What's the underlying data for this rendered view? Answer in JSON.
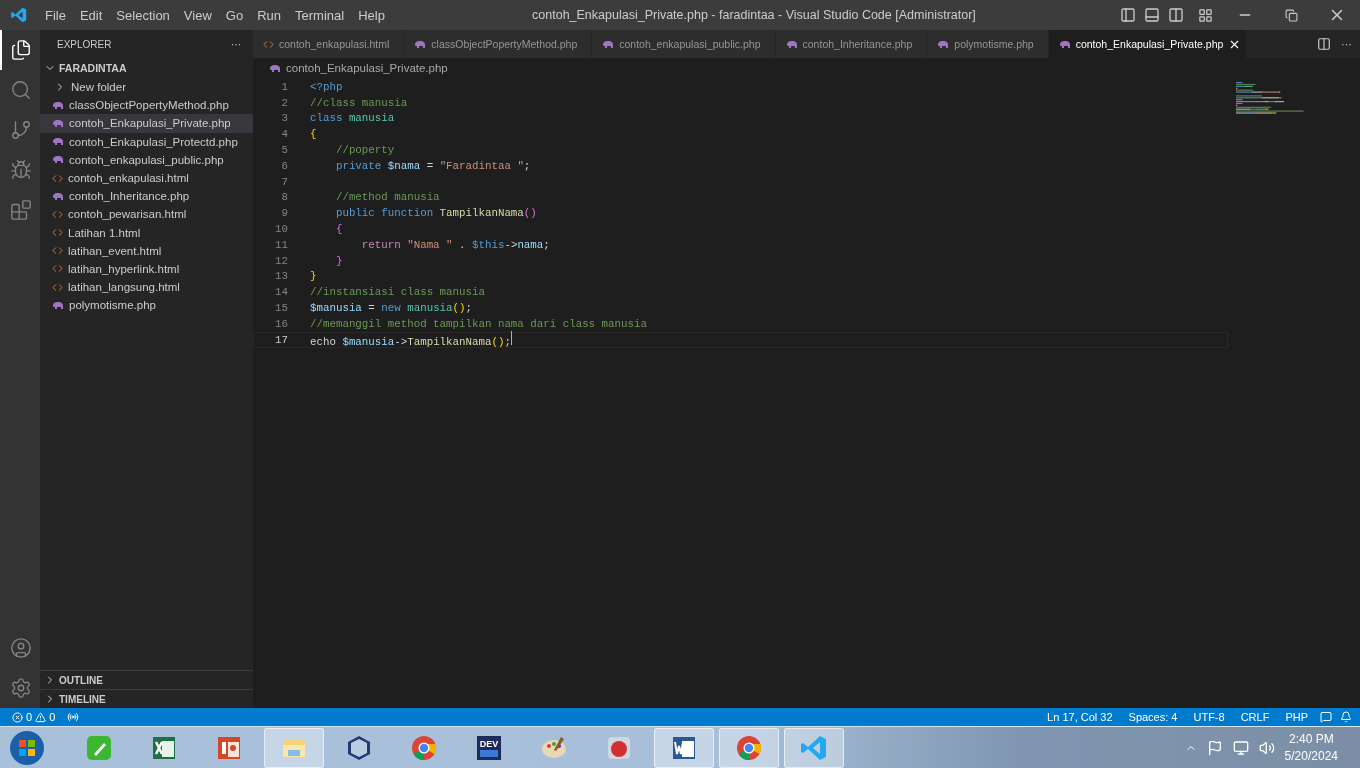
{
  "menu": [
    "File",
    "Edit",
    "Selection",
    "View",
    "Go",
    "Run",
    "Terminal",
    "Help"
  ],
  "window": {
    "title": "contoh_Enkapulasi_Private.php - faradintaa - Visual Studio Code [Administrator]"
  },
  "activity_bar": [
    {
      "kind": "files",
      "selected": true
    },
    {
      "kind": "search",
      "selected": false
    },
    {
      "kind": "source-control",
      "selected": false
    },
    {
      "kind": "run",
      "selected": false
    },
    {
      "kind": "extensions",
      "selected": false
    }
  ],
  "sidebar": {
    "title": "EXPLORER",
    "more": "···",
    "folder": {
      "name": "FARADINTAA",
      "expanded": true
    },
    "items": [
      {
        "kind": "folder",
        "name": "New folder",
        "selected": false
      },
      {
        "kind": "php",
        "name": "classObjectPopertyMethod.php",
        "selected": false
      },
      {
        "kind": "php",
        "name": "contoh_Enkapulasi_Private.php",
        "selected": true
      },
      {
        "kind": "php",
        "name": "contoh_Enkapulasi_Protectd.php",
        "selected": false
      },
      {
        "kind": "php",
        "name": "contoh_enkapulasi_public.php",
        "selected": false
      },
      {
        "kind": "html",
        "name": "contoh_enkapulasi.html",
        "selected": false
      },
      {
        "kind": "php",
        "name": "contoh_Inheritance.php",
        "selected": false
      },
      {
        "kind": "html",
        "name": "contoh_pewarisan.html",
        "selected": false
      },
      {
        "kind": "html",
        "name": "Latihan 1.html",
        "selected": false
      },
      {
        "kind": "html",
        "name": "latihan_event.html",
        "selected": false
      },
      {
        "kind": "html",
        "name": "latihan_hyperlink.html",
        "selected": false
      },
      {
        "kind": "html",
        "name": "latihan_langsung.html",
        "selected": false
      },
      {
        "kind": "php",
        "name": "polymotisme.php",
        "selected": false
      }
    ],
    "sections": [
      {
        "title": "OUTLINE",
        "expanded": false
      },
      {
        "title": "TIMELINE",
        "expanded": false
      }
    ]
  },
  "tabs": [
    {
      "kind": "html",
      "label": "contoh_enkapulasi.html",
      "selected": false
    },
    {
      "kind": "php",
      "label": "classObjectPopertyMethod.php",
      "selected": false
    },
    {
      "kind": "php",
      "label": "contoh_enkapulasi_public.php",
      "selected": false
    },
    {
      "kind": "php",
      "label": "contoh_Inheritance.php",
      "selected": false
    },
    {
      "kind": "php",
      "label": "polymotisme.php",
      "selected": false
    },
    {
      "kind": "php",
      "label": "contoh_Enkapulasi_Private.php",
      "selected": true
    }
  ],
  "tab_actions": {
    "more": "···"
  },
  "breadcrumb": {
    "kind": "php",
    "label": "contoh_Enkapulasi_Private.php"
  },
  "editor": {
    "lines": [
      {
        "number": "1",
        "current": false,
        "tokens": [
          {
            "kind": "tag",
            "text": "<?php"
          }
        ]
      },
      {
        "number": "2",
        "current": false,
        "tokens": [
          {
            "kind": "comment",
            "text": "//class manusia"
          }
        ]
      },
      {
        "number": "3",
        "current": false,
        "tokens": [
          {
            "kind": "keyword",
            "text": "class "
          },
          {
            "kind": "class",
            "text": "manusia"
          }
        ]
      },
      {
        "number": "4",
        "current": false,
        "tokens": [
          {
            "kind": "bracket1",
            "text": "{"
          }
        ]
      },
      {
        "number": "5",
        "current": false,
        "tokens": [
          {
            "kind": "comment",
            "text": "    //poperty"
          }
        ]
      },
      {
        "number": "6",
        "current": false,
        "tokens": [
          {
            "kind": "keyword",
            "text": "    private "
          },
          {
            "kind": "variable",
            "text": "$nama"
          },
          {
            "kind": "plain",
            "text": " = "
          },
          {
            "kind": "string",
            "text": "\"Faradintaa \""
          },
          {
            "kind": "plain",
            "text": ";"
          }
        ]
      },
      {
        "number": "7",
        "current": false
      },
      {
        "number": "8",
        "current": false,
        "tokens": [
          {
            "kind": "comment",
            "text": "    //method manusia"
          }
        ]
      },
      {
        "number": "9",
        "current": false,
        "tokens": [
          {
            "kind": "keyword",
            "text": "    public function "
          },
          {
            "kind": "function",
            "text": "TampilkanNama"
          },
          {
            "kind": "bracket2",
            "text": "()"
          }
        ]
      },
      {
        "number": "10",
        "current": false,
        "tokens": [
          {
            "kind": "bracket2",
            "text": "    {"
          }
        ]
      },
      {
        "number": "11",
        "current": false,
        "tokens": [
          {
            "kind": "control",
            "text": "        return "
          },
          {
            "kind": "string",
            "text": "\"Nama \""
          },
          {
            "kind": "plain",
            "text": " . "
          },
          {
            "kind": "keyword",
            "text": "$this"
          },
          {
            "kind": "plain",
            "text": "->"
          },
          {
            "kind": "variable",
            "text": "nama"
          },
          {
            "kind": "plain",
            "text": ";"
          }
        ]
      },
      {
        "number": "12",
        "current": false,
        "tokens": [
          {
            "kind": "bracket2",
            "text": "    }"
          }
        ]
      },
      {
        "number": "13",
        "current": false,
        "tokens": [
          {
            "kind": "bracket1",
            "text": "}"
          }
        ]
      },
      {
        "number": "14",
        "current": false,
        "tokens": [
          {
            "kind": "comment",
            "text": "//instansiasi class manusia"
          }
        ]
      },
      {
        "number": "15",
        "current": false,
        "tokens": [
          {
            "kind": "variable",
            "text": "$manusia"
          },
          {
            "kind": "plain",
            "text": " = "
          },
          {
            "kind": "keyword",
            "text": "new "
          },
          {
            "kind": "class",
            "text": "manusia"
          },
          {
            "kind": "bracket1",
            "text": "()"
          },
          {
            "kind": "plain",
            "text": ";"
          }
        ]
      },
      {
        "number": "16",
        "current": false,
        "tokens": [
          {
            "kind": "comment",
            "text": "//memanggil method tampilkan nama dari class manusia"
          }
        ]
      },
      {
        "number": "17",
        "current": true,
        "tokens": [
          {
            "kind": "plain",
            "text": "echo "
          },
          {
            "kind": "variable",
            "text": "$manusia"
          },
          {
            "kind": "plain",
            "text": "->"
          },
          {
            "kind": "function",
            "text": "TampilkanNama"
          },
          {
            "kind": "bracket1",
            "text": "()"
          },
          {
            "kind": "plain",
            "text": ";"
          }
        ]
      }
    ]
  },
  "status_bar": {
    "errors": "0",
    "warnings": "0",
    "right": [
      "Ln 17, Col 32",
      "Spaces: 4",
      "UTF-8",
      "CRLF",
      "PHP"
    ]
  },
  "taskbar": {
    "apps": [
      {
        "kind": "pencil",
        "active": false
      },
      {
        "kind": "excel",
        "active": false
      },
      {
        "kind": "powerpoint",
        "active": false
      },
      {
        "kind": "explorer",
        "active": true
      },
      {
        "kind": "box",
        "active": false
      },
      {
        "kind": "chrome",
        "active": false
      },
      {
        "kind": "devcpp",
        "label": "DEV",
        "active": false
      },
      {
        "kind": "paint",
        "active": false
      },
      {
        "kind": "game",
        "active": false
      },
      {
        "kind": "word",
        "active": true
      },
      {
        "kind": "chrome",
        "active": true
      },
      {
        "kind": "vscode",
        "active": true
      }
    ],
    "time": "2:40 PM",
    "date": "5/20/2024"
  }
}
